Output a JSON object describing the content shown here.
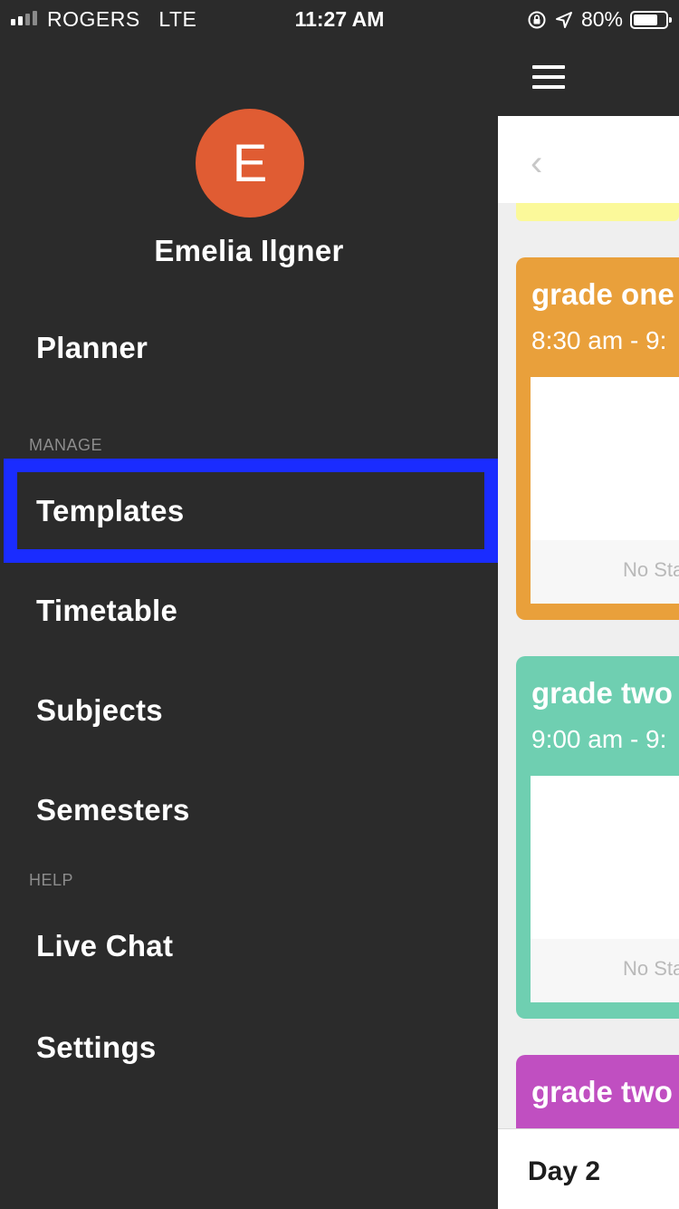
{
  "status_bar": {
    "carrier": "ROGERS",
    "network": "LTE",
    "time": "11:27 AM",
    "battery_percent": "80%",
    "battery_level": 0.8
  },
  "drawer": {
    "avatar_initial": "E",
    "avatar_color": "#e05c33",
    "user_name": "Emelia Ilgner",
    "planner_label": "Planner",
    "manage_header": "MANAGE",
    "manage_items": [
      "Templates",
      "Timetable",
      "Subjects",
      "Semesters"
    ],
    "help_header": "HELP",
    "help_items": [
      "Live Chat",
      "Settings"
    ],
    "highlight_color": "#1a2cff"
  },
  "main": {
    "cards": [
      {
        "title": "grade one",
        "time": "8:30 am - 9:",
        "footer": "No Sta",
        "color": "#e9a03b"
      },
      {
        "title": "grade two",
        "time": "9:00 am - 9:",
        "footer": "No Sta",
        "color": "#6fcfb1"
      },
      {
        "title": "grade two",
        "time": "",
        "footer": "",
        "color": "#c04fc1"
      }
    ],
    "day_label": "Day 2"
  }
}
